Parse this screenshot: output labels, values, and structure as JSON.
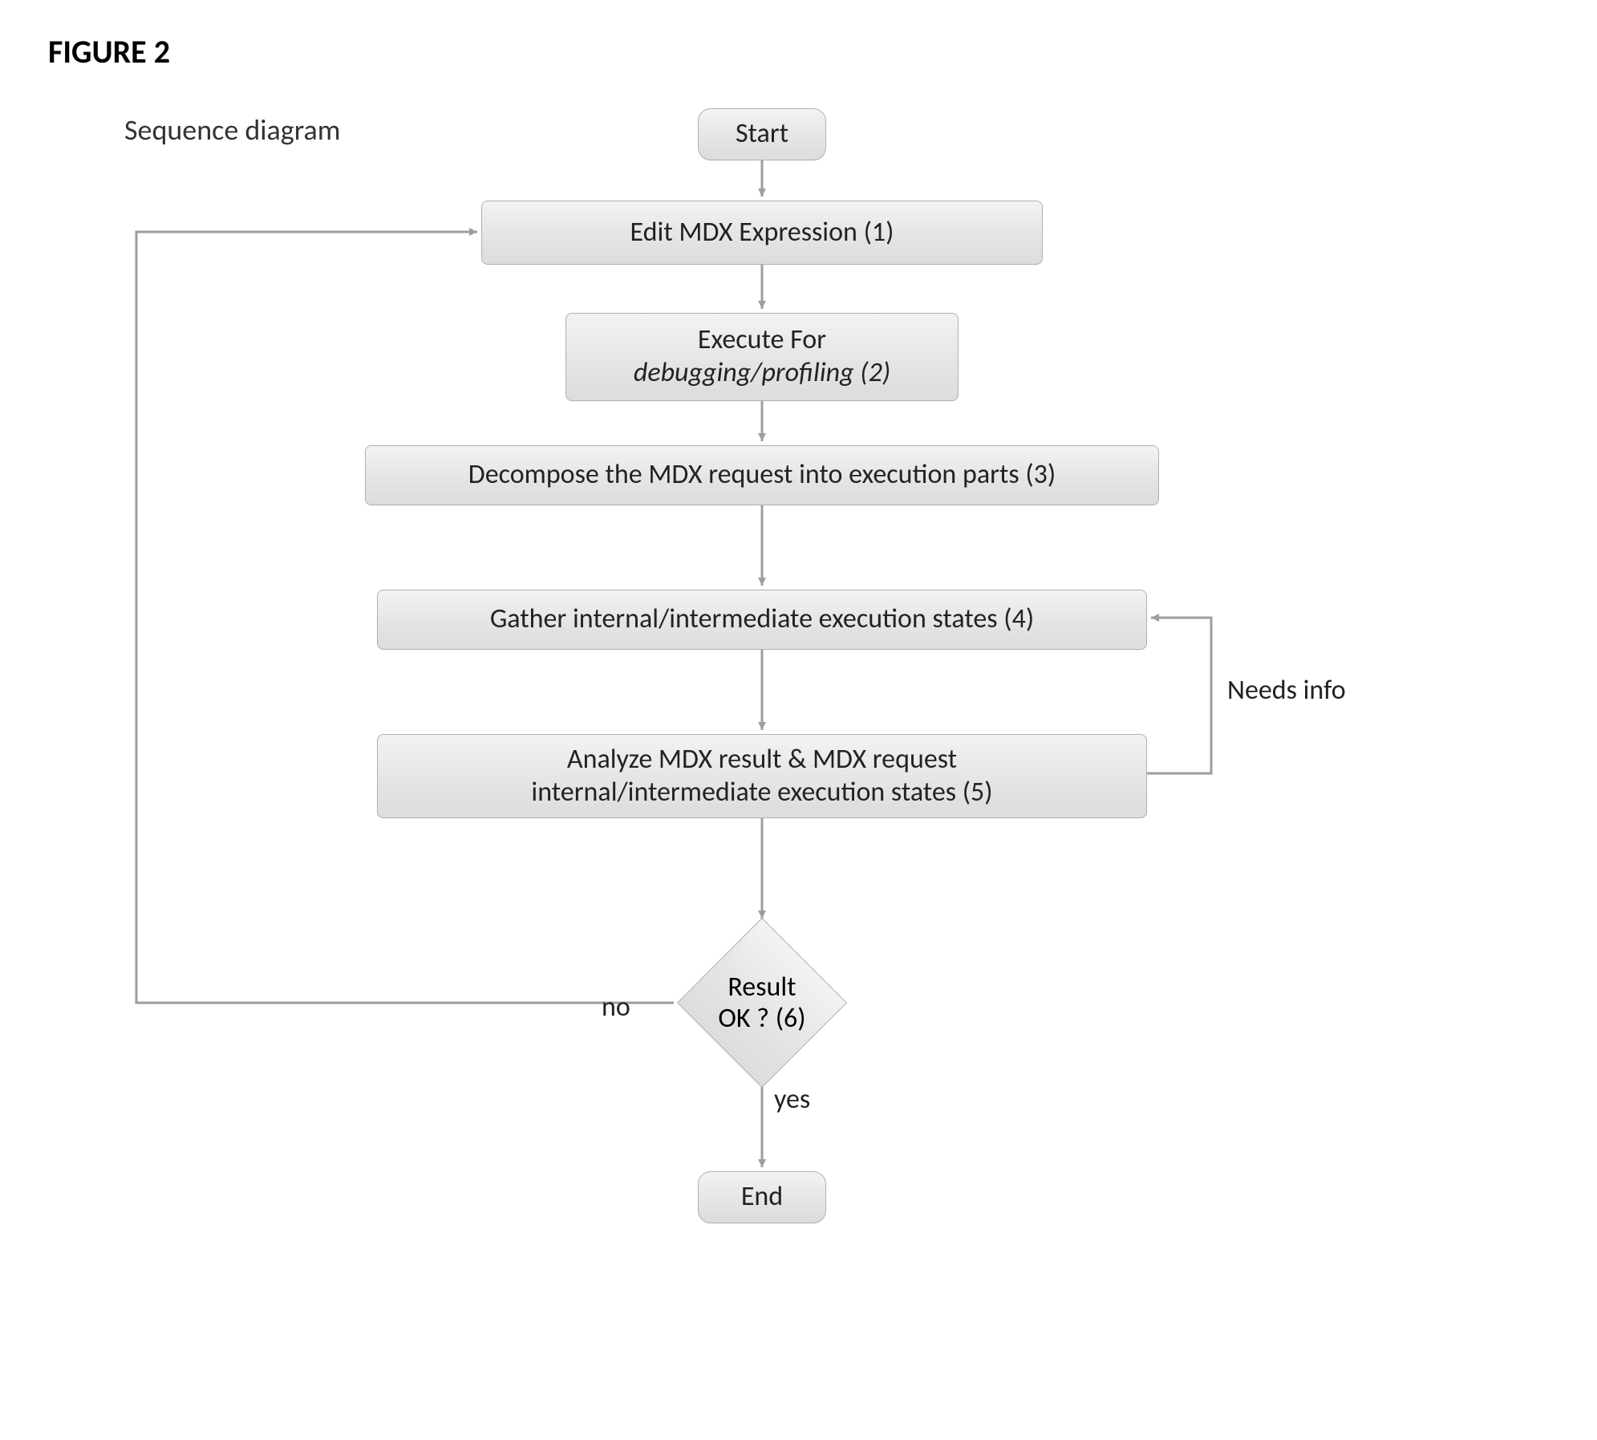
{
  "figure_title": "FIGURE 2",
  "subtitle": "Sequence diagram",
  "nodes": {
    "start": "Start",
    "edit": "Edit MDX Expression (1)",
    "exec_line1": "Execute For",
    "exec_line2": "debugging/profiling (2)",
    "decompose": "Decompose the MDX request into execution parts (3)",
    "gather": "Gather internal/intermediate execution states (4)",
    "analyze_line1": "Analyze MDX result & MDX request",
    "analyze_line2": "internal/intermediate execution states (5)",
    "decision_line1": "Result",
    "decision_line2": "OK ? (6)",
    "end": "End"
  },
  "labels": {
    "needs_info": "Needs info",
    "no": "no",
    "yes": "yes"
  }
}
